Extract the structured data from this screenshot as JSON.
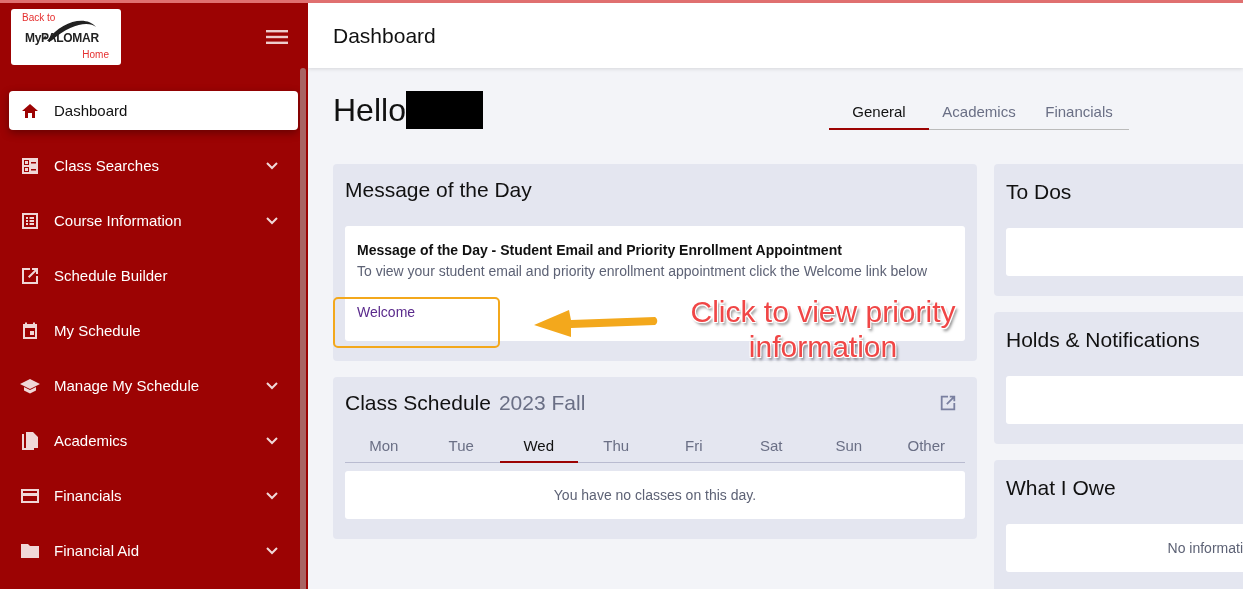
{
  "sidebar": {
    "logo": {
      "line_1": "Back to",
      "line_2": "MyPALOMAR",
      "line_3": "Home"
    },
    "items": [
      {
        "label": "Dashboard",
        "kind": "home",
        "selected": true,
        "expandable": false
      },
      {
        "label": "Class Searches",
        "kind": "list-card",
        "selected": false,
        "expandable": true
      },
      {
        "label": "Course Information",
        "kind": "list",
        "selected": false,
        "expandable": true
      },
      {
        "label": "Schedule Builder",
        "kind": "open",
        "selected": false,
        "expandable": false
      },
      {
        "label": "My Schedule",
        "kind": "calendar",
        "selected": false,
        "expandable": false
      },
      {
        "label": "Manage My Schedule",
        "kind": "cap",
        "selected": false,
        "expandable": true
      },
      {
        "label": "Academics",
        "kind": "file",
        "selected": false,
        "expandable": true
      },
      {
        "label": "Financials",
        "kind": "card",
        "selected": false,
        "expandable": true
      },
      {
        "label": "Financial Aid",
        "kind": "folder",
        "selected": false,
        "expandable": true
      }
    ]
  },
  "header": {
    "title": "Dashboard"
  },
  "greeting": "Hello",
  "tabs": [
    {
      "label": "General",
      "selected": true
    },
    {
      "label": "Academics",
      "selected": false
    },
    {
      "label": "Financials",
      "selected": false
    }
  ],
  "message_card": {
    "title": "Message of the Day",
    "message_title": "Message of the Day - Student Email and Priority Enrollment Appointment",
    "message_text": "To view your student email and priority enrollment appointment click the Welcome link below",
    "link": "Welcome"
  },
  "class_schedule": {
    "title": "Class Schedule",
    "term": "2023 Fall",
    "days": [
      {
        "label": "Mon",
        "selected": false
      },
      {
        "label": "Tue",
        "selected": false
      },
      {
        "label": "Wed",
        "selected": true
      },
      {
        "label": "Thu",
        "selected": false
      },
      {
        "label": "Fri",
        "selected": false
      },
      {
        "label": "Sat",
        "selected": false
      },
      {
        "label": "Sun",
        "selected": false
      },
      {
        "label": "Other",
        "selected": false
      }
    ],
    "empty_text": "You have no classes on this day."
  },
  "right_cards": [
    {
      "title": "To Dos"
    },
    {
      "title": "Holds & Notifications"
    },
    {
      "title": "What I Owe",
      "text": "No informati"
    }
  ],
  "annotation": {
    "text": "Click to view priority information"
  }
}
